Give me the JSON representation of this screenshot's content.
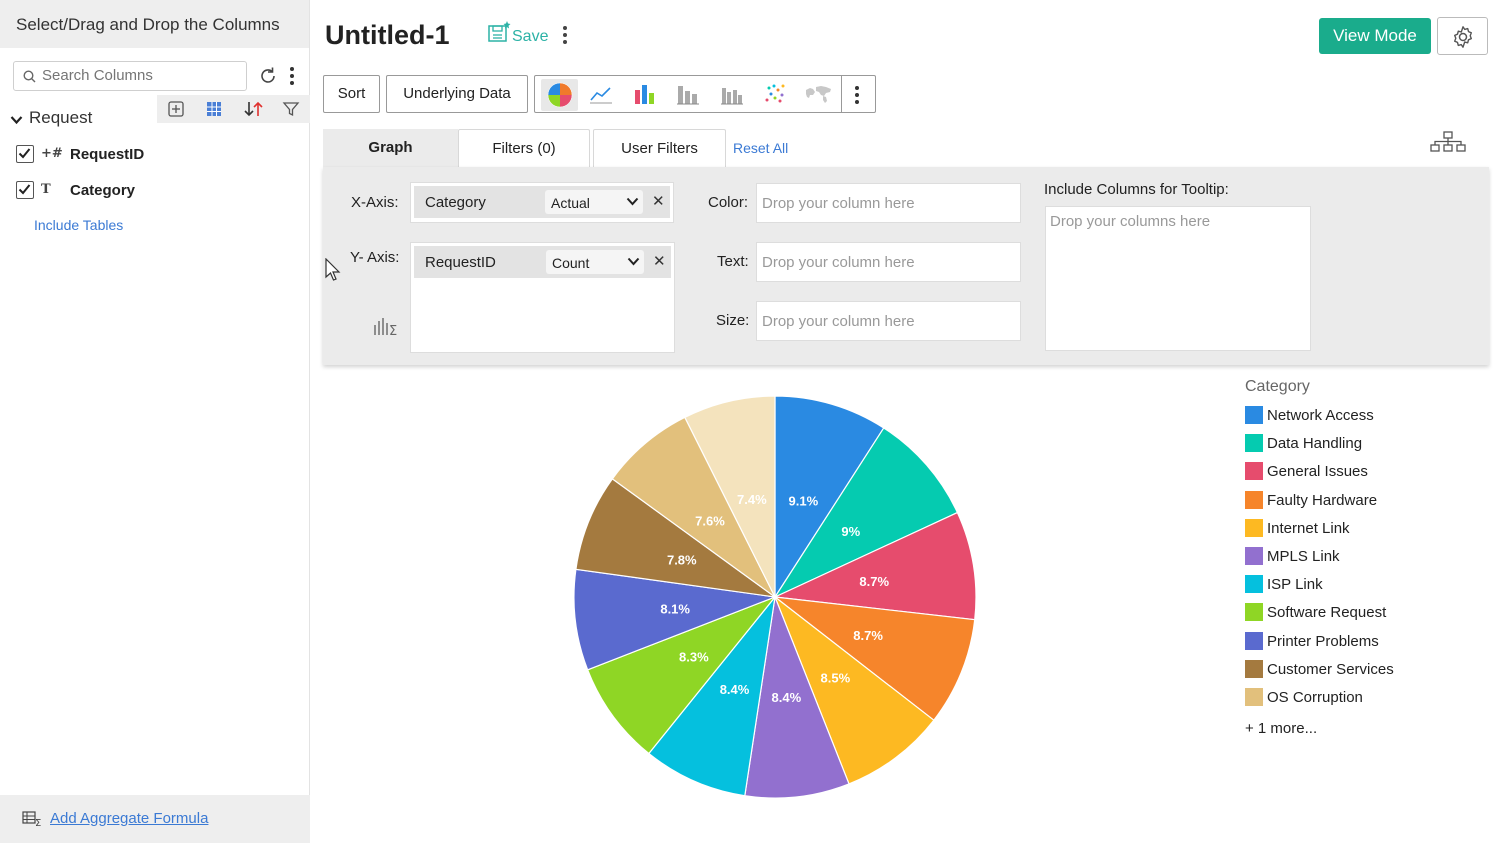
{
  "left_panel": {
    "header": "Select/Drag and Drop the Columns",
    "search_placeholder": "Search Columns",
    "table_name": "Request",
    "columns": [
      {
        "type_icon": "+#",
        "name": "RequestID"
      },
      {
        "type_icon": "T",
        "name": "Category"
      }
    ],
    "include_tables": "Include Tables",
    "footer_link": "Add Aggregate Formula"
  },
  "header": {
    "title": "Untitled-1",
    "save": "Save",
    "view_mode": "View Mode"
  },
  "toolbar": {
    "sort": "Sort",
    "underlying_data": "Underlying Data",
    "chart_types": [
      "pie-chart-icon",
      "line-chart-icon",
      "bar-chart-icon",
      "stacked-bar-icon",
      "grouped-bar-icon",
      "scatter-icon",
      "map-icon"
    ]
  },
  "tabs": {
    "graph": "Graph",
    "filters": "Filters (0)",
    "user_filters": "User Filters",
    "reset_all": "Reset All"
  },
  "shelf": {
    "x_axis_label": "X-Axis:",
    "x_axis_column": "Category",
    "x_axis_agg": "Actual",
    "y_axis_label": "Y- Axis:",
    "y_axis_column": "RequestID",
    "y_axis_agg": "Count",
    "color_label": "Color:",
    "text_label": "Text:",
    "size_label": "Size:",
    "drop_placeholder": "Drop your column here",
    "tooltip_label": "Include Columns for Tooltip:",
    "tooltip_placeholder": "Drop your columns here"
  },
  "chart_data": {
    "type": "pie",
    "legend_title": "Category",
    "legend_more": "+ 1 more...",
    "slices": [
      {
        "name": "Network Access",
        "value": 9.1,
        "label": "9.1%",
        "color": "#2a8ae2"
      },
      {
        "name": "Data Handling",
        "value": 9.0,
        "label": "9%",
        "color": "#05cbb0"
      },
      {
        "name": "General Issues",
        "value": 8.7,
        "label": "8.7%",
        "color": "#e64c6d"
      },
      {
        "name": "Faulty Hardware",
        "value": 8.7,
        "label": "8.7%",
        "color": "#f6852b"
      },
      {
        "name": "Internet Link",
        "value": 8.5,
        "label": "8.5%",
        "color": "#fdb922"
      },
      {
        "name": "MPLS Link",
        "value": 8.4,
        "label": "8.4%",
        "color": "#9270cf"
      },
      {
        "name": "ISP Link",
        "value": 8.4,
        "label": "8.4%",
        "color": "#05c0de"
      },
      {
        "name": "Software Request",
        "value": 8.3,
        "label": "8.3%",
        "color": "#8fd625"
      },
      {
        "name": "Printer Problems",
        "value": 8.1,
        "label": "8.1%",
        "color": "#5a6acf"
      },
      {
        "name": "Customer Services",
        "value": 7.8,
        "label": "7.8%",
        "color": "#a47a3f"
      },
      {
        "name": "OS Corruption",
        "value": 7.6,
        "label": "7.6%",
        "color": "#e2c07c"
      },
      {
        "name": "",
        "value": 7.4,
        "label": "7.4%",
        "color": "#f4e3bd"
      }
    ]
  }
}
